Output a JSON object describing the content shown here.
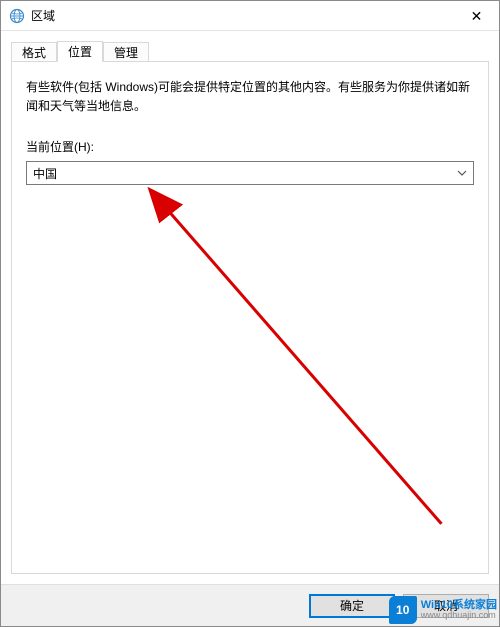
{
  "window": {
    "title": "区域",
    "close_glyph": "✕"
  },
  "tabs": {
    "format": "格式",
    "location": "位置",
    "admin": "管理"
  },
  "panel": {
    "description": "有些软件(包括 Windows)可能会提供特定位置的其他内容。有些服务为你提供诸如新闻和天气等当地信息。",
    "current_location_label": "当前位置(H):",
    "current_location_value": "中国"
  },
  "buttons": {
    "ok": "确定",
    "cancel": "取消"
  },
  "watermark": {
    "badge": "10",
    "line1": "Win10系统家园",
    "line2": "www.qdhuajin.com"
  }
}
